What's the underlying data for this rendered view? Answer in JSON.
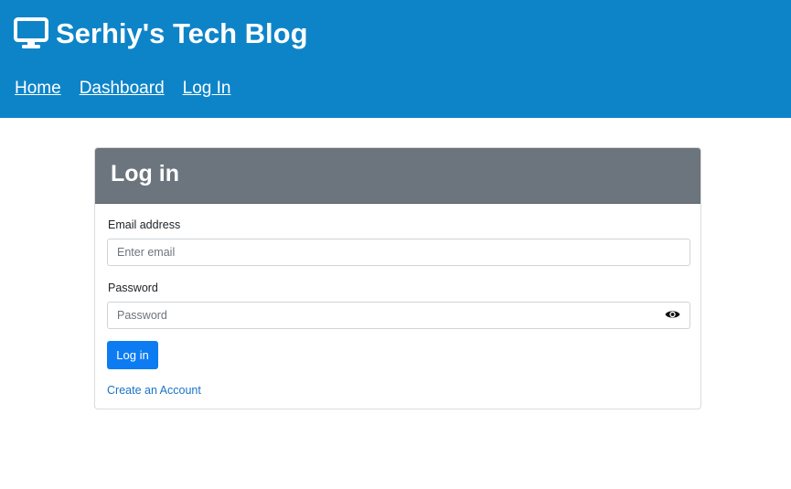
{
  "header": {
    "brand_icon": "monitor-icon",
    "title": "Serhiy's Tech Blog",
    "nav": [
      {
        "label": "Home"
      },
      {
        "label": "Dashboard"
      },
      {
        "label": "Log In"
      }
    ]
  },
  "login_card": {
    "title": "Log in",
    "email_label": "Email address",
    "email_placeholder": "Enter email",
    "email_value": "",
    "password_label": "Password",
    "password_placeholder": "Password",
    "password_value": "",
    "password_toggle_icon": "eye-icon",
    "submit_label": "Log in",
    "create_account_link": "Create an Account"
  },
  "colors": {
    "header_bg": "#0e84c8",
    "card_header_bg": "#6c757d",
    "primary_button": "#0d7cf2",
    "link": "#1a73c8"
  }
}
